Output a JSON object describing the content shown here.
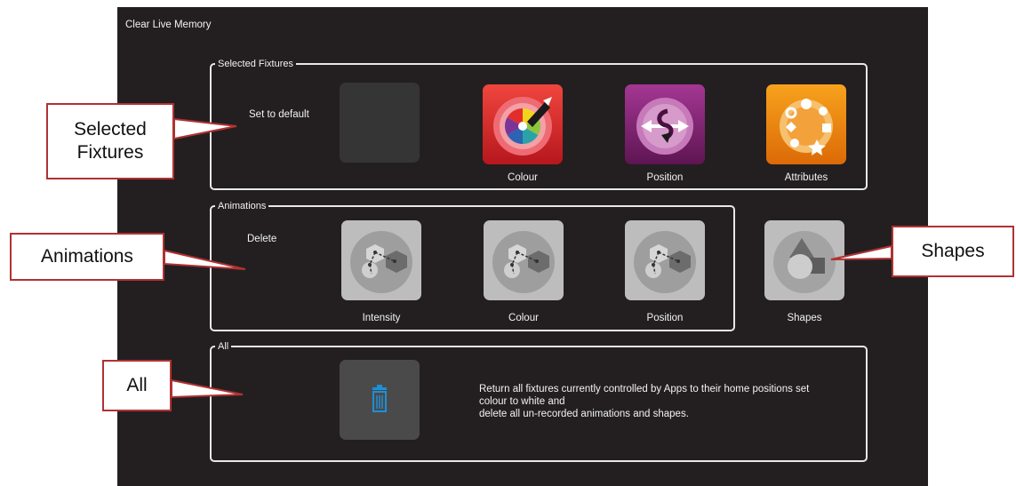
{
  "app": {
    "title": "Clear Live Memory"
  },
  "selected_fixtures": {
    "label": "Selected Fixtures",
    "hint": "Set to default",
    "tiles": [
      {
        "label": "Colour",
        "icon": "color-wheel-icon",
        "color": "#d8262c"
      },
      {
        "label": "Position",
        "icon": "position-arrows-icon",
        "color": "#7b1f6b"
      },
      {
        "label": "Attributes",
        "icon": "attributes-icon",
        "color": "#ef7d0d"
      }
    ]
  },
  "animations": {
    "label": "Animations",
    "hint": "Delete",
    "tiles": [
      {
        "label": "Intensity",
        "icon": "animation-path-icon"
      },
      {
        "label": "Colour",
        "icon": "animation-path-icon"
      },
      {
        "label": "Position",
        "icon": "animation-path-icon"
      }
    ]
  },
  "shapes": {
    "label": "Shapes",
    "icon": "shapes-icon"
  },
  "all": {
    "label": "All",
    "icon": "trash-icon",
    "description": [
      "Return all fixtures currently controlled by Apps to their home positions set",
      "colour to white and",
      "delete all un-recorded animations and shapes."
    ]
  },
  "callouts": {
    "selected_fixtures": [
      "Selected",
      "Fixtures"
    ],
    "animations": "Animations",
    "shapes": "Shapes",
    "all": "All"
  },
  "colors": {
    "background": "#231f20",
    "callout_border": "#b03232",
    "trash_blue": "#1e8fd6"
  }
}
